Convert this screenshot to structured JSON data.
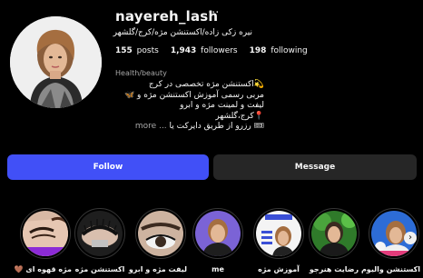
{
  "profile": {
    "username": "nayereh_lash",
    "more_icon": "more-horizontal-icon",
    "full_name": "نیره زکی زاده/اکستنشن مژه/کرج/گلشهر",
    "stats": {
      "posts_count": "155",
      "posts_label": "posts",
      "followers_count": "1,943",
      "followers_label": "followers",
      "following_count": "198",
      "following_label": "following"
    },
    "category": "Health/beauty",
    "bio": [
      "💫اکستنشن مژه تخصصی در کرج",
      "مربی رسمی آموزش اکستنشن مژه و 🦋",
      "لیفت و لمینت مژه و ابرو",
      "📍کرج،گلشهر",
      "🎟 رزرو از طریق دایرکت یا"
    ],
    "more_label": "... more"
  },
  "actions": {
    "follow_label": "Follow",
    "message_label": "Message",
    "follow_color": "#4150f7"
  },
  "highlights": [
    {
      "label": "مژه قهوه ای 🤎"
    },
    {
      "label": "اکستنشن مژه"
    },
    {
      "label": "لیفت مژه و ابرو"
    },
    {
      "label": "me"
    },
    {
      "label": "آموزش مژه"
    },
    {
      "label": "رضایت هنرجو"
    },
    {
      "label": "اکستنشن والیوم"
    }
  ],
  "scroll_icon": "chevron-right-icon"
}
